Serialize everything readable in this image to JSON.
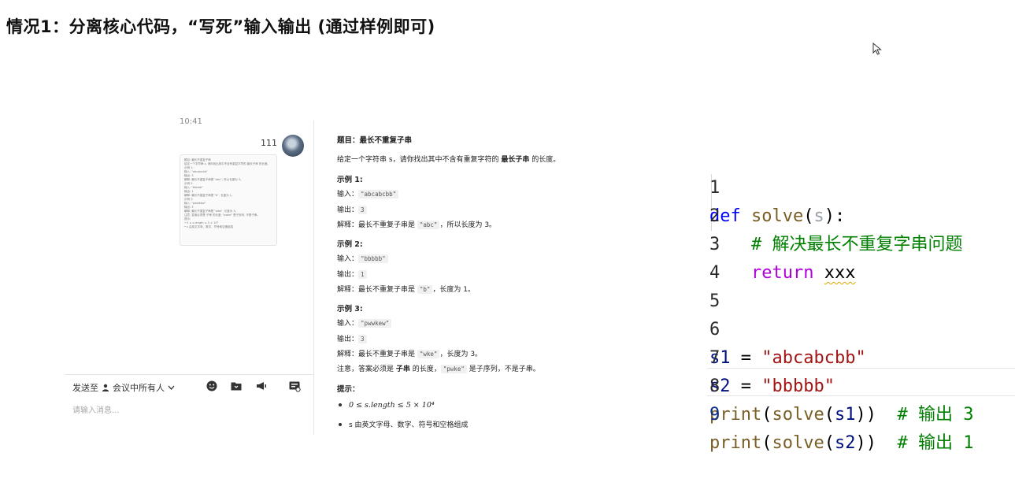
{
  "slide": {
    "title": "情况1：分离核心代码，“写死”输入输出 (通过样例即可)"
  },
  "chat": {
    "time": "10:41",
    "sender": "111",
    "bubble_lines": [
      "题目: 最长不重复子串",
      "给定一个字符串 s, 请你找出其中不含有重复字符的 最长子串 的长度。",
      "示例 1:",
      "输入: \"abcabcbb\"",
      "输出: 3",
      "解释: 最长不重复子串是 \"abc\", 所以长度为 3。",
      "示例 2:",
      "输入: \"bbbbb\"",
      "输出: 1",
      "解释: 最长不重复子串是 \"b\", 长度为 1。",
      "示例 3:",
      "输入: \"pwwkew\"",
      "输出: 3",
      "解释: 最长不重复子串是 \"wke\", 长度为 3。",
      "注意, 答案必须是 子串 的长度, \"pwke\" 是子序列, 不是子串。",
      "提示:",
      "• 0 ≤ s.length ≤ 5 × 10⁴",
      "• s 由英文字母、数字、符号和空格组成"
    ],
    "send_to_label": "发送至",
    "send_to_target": "会议中所有人",
    "input_placeholder": "请输入消息..."
  },
  "problem": {
    "title": "题目：最长不重复子串",
    "desc_pre": "给定一个字符串 s，请你找出其中不含有重复字符的 ",
    "desc_bold": "最长子串",
    "desc_post": " 的长度。",
    "in_label": "输入：",
    "out_label": "输出：",
    "ex1_title": "示例 1:",
    "ex1_input": "\"abcabcbb\"",
    "ex1_output": "3",
    "ex1_explain_pre": "解释：最长不重复子串是 ",
    "ex1_explain_chip": "\"abc\"",
    "ex1_explain_post": "，所以长度为 3。",
    "ex2_title": "示例 2:",
    "ex2_input": "\"bbbbb\"",
    "ex2_output": "1",
    "ex2_explain_pre": "解释：最长不重复子串是 ",
    "ex2_explain_chip": "\"b\"",
    "ex2_explain_post": "，长度为 1。",
    "ex3_title": "示例 3:",
    "ex3_input": "\"pwwkew\"",
    "ex3_output": "3",
    "ex3_explain_pre": "解释：最长不重复子串是 ",
    "ex3_explain_chip": "\"wke\"",
    "ex3_explain_post": "，长度为 3。",
    "note_pre": "注意，答案必须是 ",
    "note_bold": "子串",
    "note_mid": " 的长度，",
    "note_chip": "\"pwke\"",
    "note_post": " 是子序列，不是子串。",
    "hint_title": "提示：",
    "hint1": "0 ≤ s.length ≤ 5 × 10⁴",
    "hint2": "s 由英文字母、数字、符号和空格组成"
  },
  "code": {
    "line_numbers": [
      "1",
      "2",
      "3",
      "4",
      "5",
      "6",
      "7",
      "8",
      "9"
    ],
    "l1_def": "def",
    "l1_fn": "solve",
    "l1_open": "(",
    "l1_param": "s",
    "l1_close": "):",
    "l2_comment": "# 解决最长不重复字串问题",
    "l3_return": "return",
    "l3_value": "xxx",
    "l6_var": "s1",
    "l6_eq": " = ",
    "l6_str": "\"abcabcbb\"",
    "l7_var": "s2",
    "l7_eq": " = ",
    "l7_str": "\"bbbbb\"",
    "l8_print": "print",
    "l8_open": "(",
    "l8_solve": "solve",
    "l8_open2": "(",
    "l8_arg": "s1",
    "l8_close": "))",
    "l8_comment": "# 输出 3",
    "l9_print": "print",
    "l9_open": "(",
    "l9_solve": "solve",
    "l9_open2": "(",
    "l9_arg": "s2",
    "l9_close": "))",
    "l9_comment": "# 输出 1"
  }
}
